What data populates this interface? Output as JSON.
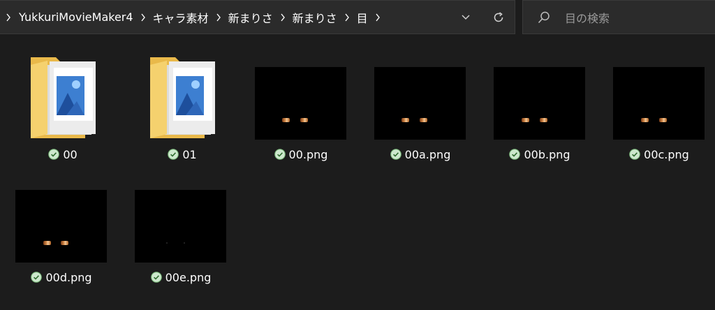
{
  "addressbar": {
    "breadcrumbs": [
      {
        "label": "YukkuriMovieMaker4"
      },
      {
        "label": "キャラ素材"
      },
      {
        "label": "新まりさ"
      },
      {
        "label": "新まりさ"
      },
      {
        "label": "目"
      }
    ]
  },
  "search": {
    "placeholder": "目の検索"
  },
  "items": [
    {
      "name": "00",
      "type": "folder"
    },
    {
      "name": "01",
      "type": "folder"
    },
    {
      "name": "00.png",
      "type": "image"
    },
    {
      "name": "00a.png",
      "type": "image"
    },
    {
      "name": "00b.png",
      "type": "image"
    },
    {
      "name": "00c.png",
      "type": "image"
    },
    {
      "name": "00d.png",
      "type": "image"
    },
    {
      "name": "00e.png",
      "type": "image"
    }
  ],
  "colors": {
    "background": "#1c1c1c",
    "bar": "#2b2b2b",
    "sync_green": "#8fcf8f",
    "folder_yellow": "#f4cf6a"
  },
  "icons": {
    "separator": "chevron-right-icon",
    "dropdown": "chevron-down-icon",
    "refresh": "refresh-icon",
    "search": "search-icon",
    "status": "check-circle-icon"
  }
}
